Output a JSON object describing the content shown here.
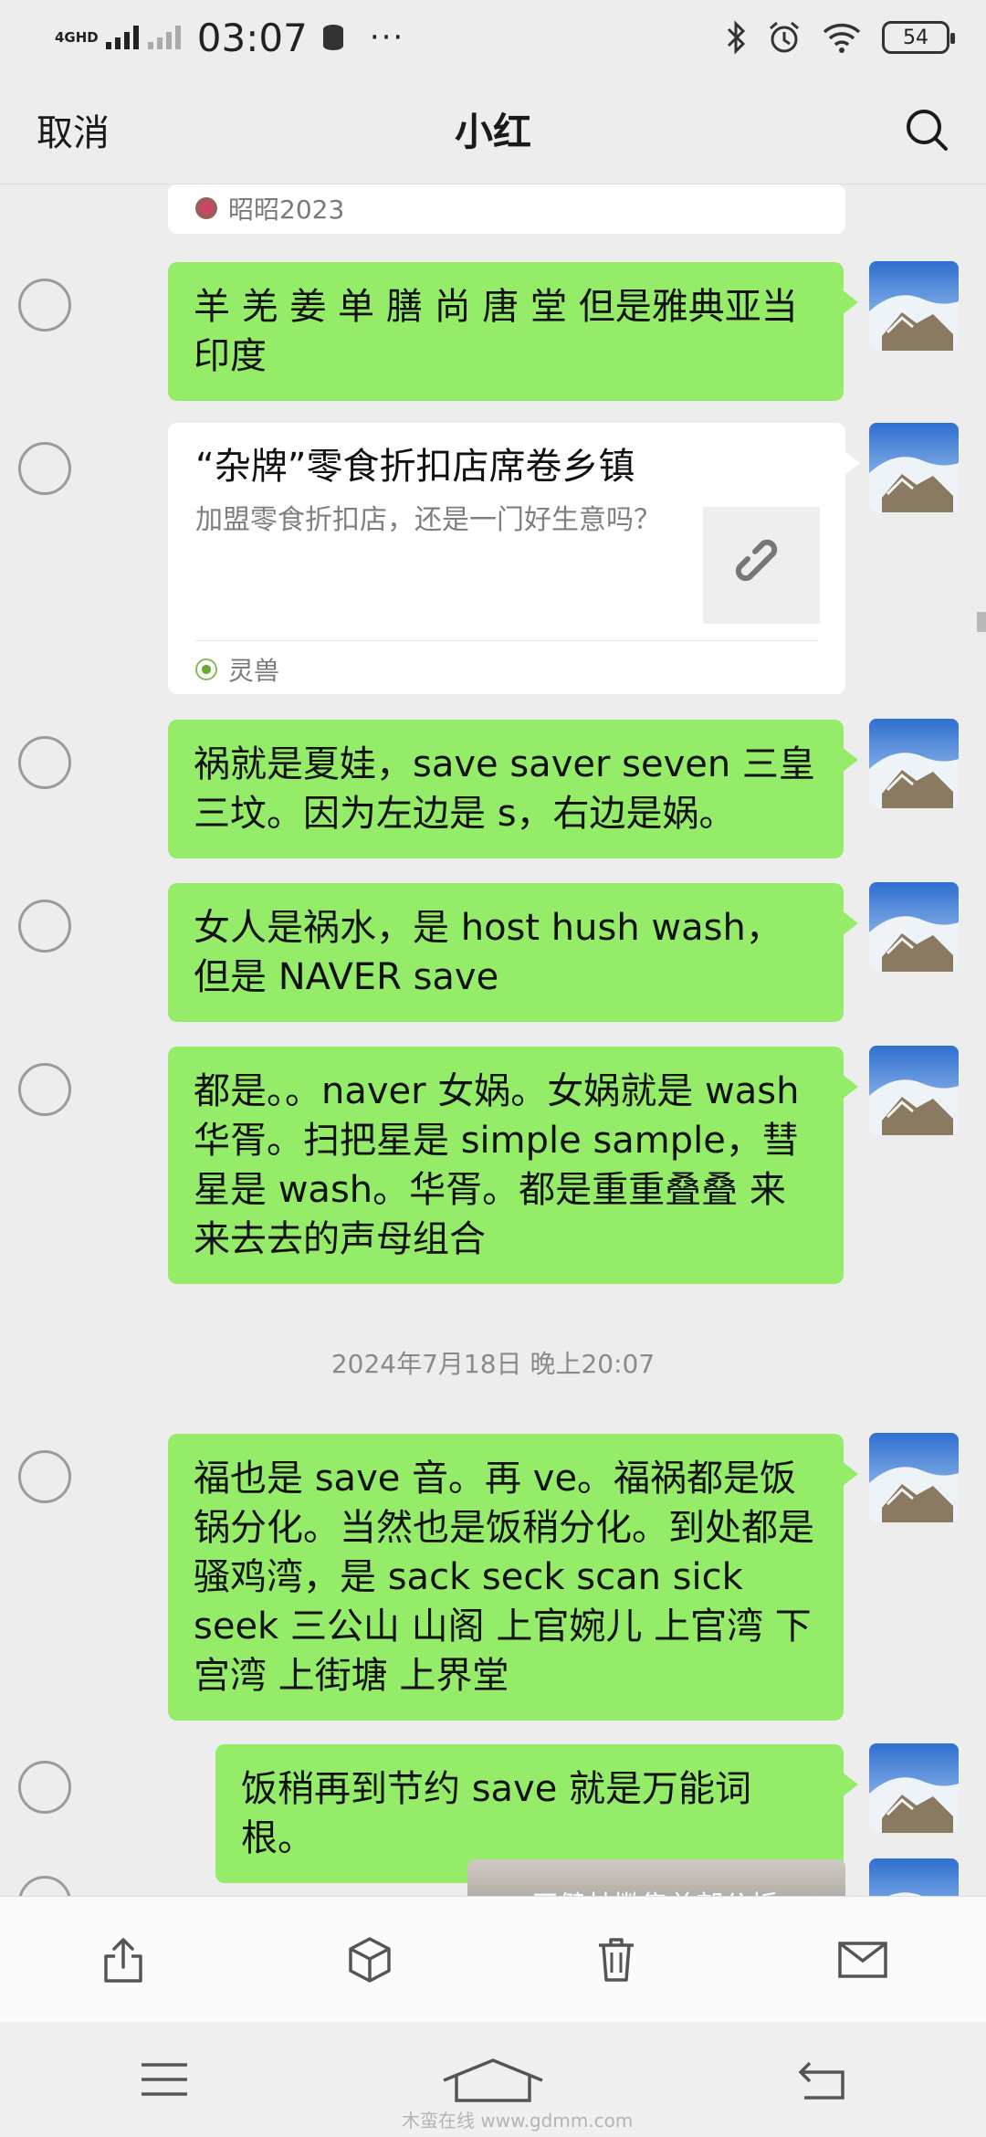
{
  "status": {
    "network": "4G",
    "network_sub": "HD",
    "time": "03:07",
    "battery": "54",
    "more": "···"
  },
  "nav": {
    "cancel": "取消",
    "title": "小红"
  },
  "messages": [
    {
      "type": "source-footer",
      "source": "昭昭2023"
    },
    {
      "type": "text",
      "text": "羊 羌 姜 单 膳 尚 唐 堂 但是雅典亚当印度"
    },
    {
      "type": "link",
      "title": "“杂牌”零食折扣店席卷乡镇",
      "desc": "加盟零食折扣店，还是一门好生意吗？",
      "source": "灵兽"
    },
    {
      "type": "text",
      "text": "祸就是夏娃，save saver seven 三皇三坟。因为左边是 s，右边是娲。"
    },
    {
      "type": "text",
      "text": "女人是祸水，是 host hush wash，但是 NAVER save"
    },
    {
      "type": "text",
      "text": "都是。。naver 女娲。女娲就是 wash 华胥。扫把星是 simple sample，彗星是 wash。华胥。都是重重叠叠 来来去去的声母组合"
    },
    {
      "type": "date",
      "text": "2024年7月18日 晚上20:07"
    },
    {
      "type": "text",
      "text": "福也是 save 音。再 ve。福祸都是饭锅分化。当然也是饭稍分化。到处都是骚鸡湾，是 sack seck scan sick seek 三公山 山阁 上官婉儿 上官湾 下宫湾 上街塘 上界堂"
    },
    {
      "type": "text",
      "text": "饭稍再到节约 save 就是万能词根。"
    },
    {
      "type": "video",
      "caption": "王健林撇售总部公折"
    }
  ],
  "toolbar": {
    "share": "share-icon",
    "box": "box-icon",
    "delete": "trash-icon",
    "mail": "mail-icon"
  },
  "watermark": "木蛮在线  www.gdmm.com",
  "colors": {
    "bubble": "#95ec69",
    "background": "#ededed"
  }
}
